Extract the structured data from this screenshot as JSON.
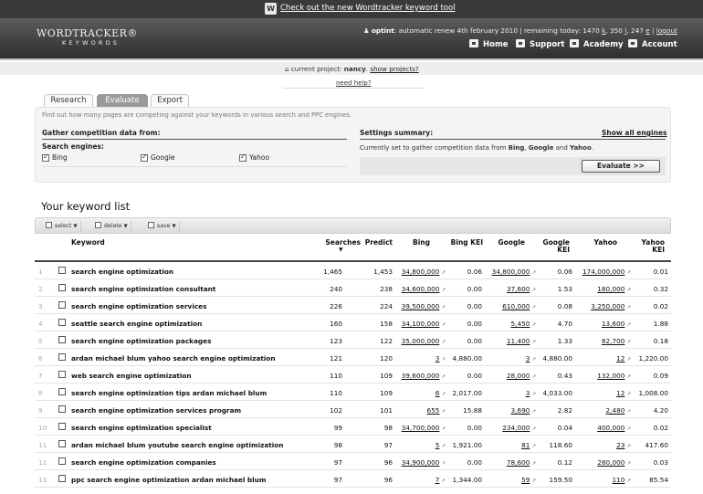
{
  "banner": {
    "logo_letter": "W",
    "text": "Check out the new Wordtracker keyword tool"
  },
  "header": {
    "logo_main": "WORDTRACKER®",
    "logo_sub": "KEYWORDS",
    "user": "optint",
    "plan_text": ": automatic renew 4th february 2010 | remaining today: 1470",
    "quota_k": "k",
    "quota_350": ", 350",
    "quota_l": "l",
    "quota_247": ", 247",
    "quota_e": "e",
    "sep": " | ",
    "logout": "logout",
    "nav": [
      "Home",
      "Support",
      "Academy",
      "Account"
    ]
  },
  "project": {
    "label": "current project:",
    "name": "nancy",
    "show": "show projects?",
    "help": "need help?"
  },
  "tabs": [
    "Research",
    "Evaluate",
    "Export"
  ],
  "panel": {
    "description": "Find out how many pages are competing against your keywords in various search and PPC engines.",
    "gather_title": "Gather competition data from:",
    "engines_label": "Search engines:",
    "engines": [
      "Bing",
      "Google",
      "Yahoo"
    ],
    "settings_title": "Settings summary:",
    "show_all": "Show all engines",
    "summary_pre": "Currently set to gather competition data from",
    "summary_b1": "Bing",
    "summary_c": ",",
    "summary_b2": "Google",
    "summary_and": "and",
    "summary_b3": "Yahoo",
    "summary_end": ".",
    "evaluate_button": "Evaluate >>"
  },
  "list": {
    "title": "Your keyword list",
    "toolbar": [
      "select",
      "delete",
      "save"
    ],
    "headers": {
      "keyword": "Keyword",
      "searches": "Searches",
      "predict": "Predict",
      "bing": "Bing",
      "bing_kei_1": "Bing KEI",
      "google": "Google",
      "google_kei_1": "Google",
      "google_kei_2": "KEI",
      "yahoo": "Yahoo",
      "yahoo_kei_1": "Yahoo",
      "yahoo_kei_2": "KEI"
    },
    "rows": [
      {
        "n": "1",
        "kw": "search engine optimization",
        "s": "1,465",
        "p": "1,453",
        "b": "34,800,000",
        "bk": "0.06",
        "g": "34,800,000",
        "gk": "0.06",
        "y": "174,000,000",
        "yk": "0.01"
      },
      {
        "n": "2",
        "kw": "search engine optimization consultant",
        "s": "240",
        "p": "238",
        "b": "34,600,000",
        "bk": "0.00",
        "g": "37,600",
        "gk": "1.53",
        "y": "180,000",
        "yk": "0.32"
      },
      {
        "n": "3",
        "kw": "search engine optimization services",
        "s": "226",
        "p": "224",
        "b": "39,500,000",
        "bk": "0.00",
        "g": "610,000",
        "gk": "0.08",
        "y": "3,250,000",
        "yk": "0.02"
      },
      {
        "n": "4",
        "kw": "seattle search engine optimization",
        "s": "160",
        "p": "158",
        "b": "34,100,000",
        "bk": "0.00",
        "g": "5,450",
        "gk": "4.70",
        "y": "13,600",
        "yk": "1.88"
      },
      {
        "n": "5",
        "kw": "search engine optimization packages",
        "s": "123",
        "p": "122",
        "b": "35,000,000",
        "bk": "0.00",
        "g": "11,400",
        "gk": "1.33",
        "y": "82,700",
        "yk": "0.18"
      },
      {
        "n": "6",
        "kw": "ardan michael blum yahoo search engine optimization",
        "s": "121",
        "p": "120",
        "b": "3",
        "bk": "4,880.00",
        "g": "3",
        "gk": "4,880.00",
        "y": "12",
        "yk": "1,220.00"
      },
      {
        "n": "7",
        "kw": "web search engine optimization",
        "s": "110",
        "p": "109",
        "b": "39,600,000",
        "bk": "0.00",
        "g": "28,000",
        "gk": "0.43",
        "y": "132,000",
        "yk": "0.09"
      },
      {
        "n": "8",
        "kw": "search engine optimization tips ardan michael blum",
        "s": "110",
        "p": "109",
        "b": "6",
        "bk": "2,017.00",
        "g": "3",
        "gk": "4,033.00",
        "y": "12",
        "yk": "1,008.00"
      },
      {
        "n": "9",
        "kw": "search engine optimization services program",
        "s": "102",
        "p": "101",
        "b": "655",
        "bk": "15.88",
        "g": "3,690",
        "gk": "2.82",
        "y": "2,480",
        "yk": "4.20"
      },
      {
        "n": "10",
        "kw": "search engine optimization specialist",
        "s": "99",
        "p": "98",
        "b": "34,700,000",
        "bk": "0.00",
        "g": "234,000",
        "gk": "0.04",
        "y": "400,000",
        "yk": "0.02"
      },
      {
        "n": "11",
        "kw": "ardan michael blum youtube search engine optimization",
        "s": "98",
        "p": "97",
        "b": "5",
        "bk": "1,921.00",
        "g": "81",
        "gk": "118.60",
        "y": "23",
        "yk": "417.60"
      },
      {
        "n": "12",
        "kw": "search engine optimization companies",
        "s": "97",
        "p": "96",
        "b": "34,900,000",
        "bk": "0.00",
        "g": "78,600",
        "gk": "0.12",
        "y": "280,000",
        "yk": "0.03"
      },
      {
        "n": "13",
        "kw": "ppc search engine optimization ardan michael blum",
        "s": "97",
        "p": "96",
        "b": "7",
        "bk": "1,344.00",
        "g": "59",
        "gk": "159.50",
        "y": "110",
        "yk": "85.54"
      }
    ]
  }
}
